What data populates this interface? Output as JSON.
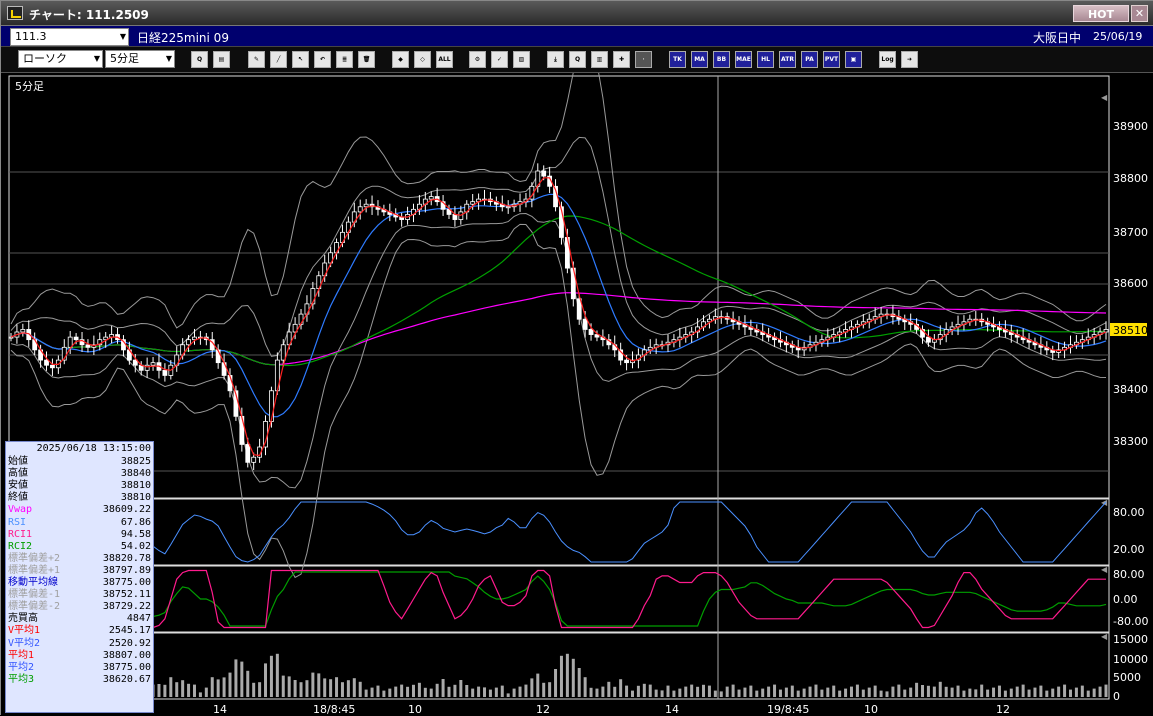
{
  "window": {
    "title": "チャート: 111.2509",
    "hot_label": "HOT",
    "close_label": "✕"
  },
  "infobar": {
    "code": "111.3",
    "name": "日経225mini 09",
    "session": "大阪日中",
    "date": "25/06/19"
  },
  "toolbar": {
    "chart_type": "ローソク",
    "interval": "5分足",
    "buttons": [
      {
        "icon": "zoom-icon",
        "text": "Q"
      },
      {
        "icon": "window-icon",
        "text": "▤"
      },
      {
        "icon": "pencil-icon",
        "text": "✎"
      },
      {
        "icon": "line-tool-icon",
        "text": "╱"
      },
      {
        "icon": "cursor-icon",
        "text": "↖"
      },
      {
        "icon": "undo-icon",
        "text": "↶"
      },
      {
        "icon": "notes-icon",
        "text": "≣"
      },
      {
        "icon": "trash-icon",
        "text": "🗑"
      },
      {
        "icon": "candle-width-icon",
        "text": "◆"
      },
      {
        "icon": "candle-narrow-icon",
        "text": "◇"
      },
      {
        "icon": "all-icon",
        "text": "ALL"
      },
      {
        "icon": "settings-icon",
        "text": "⚙"
      },
      {
        "icon": "wrench-icon",
        "text": "✓"
      },
      {
        "icon": "color-icon",
        "text": "▨"
      },
      {
        "icon": "download-icon",
        "text": "⤓"
      },
      {
        "icon": "search-chart-icon",
        "text": "Q"
      },
      {
        "icon": "bar-chart-icon",
        "text": "▥"
      },
      {
        "icon": "split-icon",
        "text": "✚"
      },
      {
        "icon": "disabled-icon",
        "text": "·"
      },
      {
        "icon": "indicator-icon",
        "text": "TK"
      },
      {
        "icon": "ma-icon",
        "text": "MA"
      },
      {
        "icon": "bb-icon",
        "text": "BB"
      },
      {
        "icon": "mae-icon",
        "text": "MAE"
      },
      {
        "icon": "hl-icon",
        "text": "HL"
      },
      {
        "icon": "atr-icon",
        "text": "ATR"
      },
      {
        "icon": "para-icon",
        "text": "PA"
      },
      {
        "icon": "pvt-icon",
        "text": "PVT"
      },
      {
        "icon": "frame-icon",
        "text": "▣"
      },
      {
        "icon": "log-icon",
        "text": "Log"
      },
      {
        "icon": "export-icon",
        "text": "➜"
      }
    ]
  },
  "colors": {
    "candle": "#ffffff",
    "ma_short": "#ff2020",
    "ma_mid": "#2e7bff",
    "ma_long": "#00a000",
    "vwap": "#ff00ff",
    "bands": "#999999",
    "rsi": "#4a90ff",
    "rci1": "#ff1b8d",
    "rci2": "#009e00",
    "price_tag_bg": "#ffe000",
    "panel_border": "#dddddd",
    "crosshair": "#aaaaaa"
  },
  "main_chart": {
    "label": "5分足",
    "price_axis": [
      "38900",
      "38800",
      "38700",
      "38600",
      "38400",
      "38300"
    ],
    "current_price": "38510",
    "time_axis": [
      "14",
      "18/8:45",
      "10",
      "12",
      "14",
      "19/8:45",
      "10",
      "12"
    ]
  },
  "rsi_panel": {
    "axis": [
      "80.00",
      "20.00"
    ]
  },
  "rci_panel": {
    "axis": [
      "80.00",
      "0.00",
      "-80.00"
    ]
  },
  "volume_panel": {
    "axis": [
      "15000",
      "10000",
      "5000",
      "0"
    ]
  },
  "data_panel": {
    "datetime": "2025/06/18  13:15:00",
    "rows": [
      {
        "label": "始値",
        "value": "38825",
        "color": "#000000"
      },
      {
        "label": "高値",
        "value": "38840",
        "color": "#000000"
      },
      {
        "label": "安値",
        "value": "38810",
        "color": "#000000"
      },
      {
        "label": "終値",
        "value": "38810",
        "color": "#000000"
      },
      {
        "label": "Vwap",
        "value": "38609.22",
        "color": "#ff00ff"
      },
      {
        "label": "RSI",
        "value": "67.86",
        "color": "#4a90ff"
      },
      {
        "label": "RCI1",
        "value": "94.58",
        "color": "#ff1b8d"
      },
      {
        "label": "RCI2",
        "value": "54.02",
        "color": "#009e00"
      },
      {
        "label": "標準偏差+2",
        "value": "38820.78",
        "color": "#a0a0a0"
      },
      {
        "label": "標準偏差+1",
        "value": "38797.89",
        "color": "#a0a0a0"
      },
      {
        "label": "移動平均線",
        "value": "38775.00",
        "color": "#0000cc"
      },
      {
        "label": "標準偏差-1",
        "value": "38752.11",
        "color": "#a0a0a0"
      },
      {
        "label": "標準偏差-2",
        "value": "38729.22",
        "color": "#a0a0a0"
      },
      {
        "label": "売買高",
        "value": "4847",
        "color": "#000000"
      },
      {
        "label": "V平均1",
        "value": "2545.17",
        "color": "#ff0000"
      },
      {
        "label": "V平均2",
        "value": "2520.92",
        "color": "#3355ff"
      },
      {
        "label": "平均1",
        "value": "38807.00",
        "color": "#ff0000"
      },
      {
        "label": "平均2",
        "value": "38775.00",
        "color": "#3355ff"
      },
      {
        "label": "平均3",
        "value": "38620.67",
        "color": "#009e00"
      }
    ]
  },
  "chart_data": {
    "type": "candlestick",
    "interval": "5分足",
    "symbol": "日経225mini 09",
    "time_labels": [
      "14",
      "18/8:45",
      "10",
      "12",
      "14",
      "19/8:45",
      "10",
      "12"
    ],
    "ylim": [
      38240,
      39050
    ],
    "closes": [
      38545,
      38555,
      38560,
      38540,
      38520,
      38500,
      38490,
      38485,
      38500,
      38525,
      38545,
      38540,
      38530,
      38525,
      38530,
      38540,
      38545,
      38550,
      38540,
      38520,
      38500,
      38490,
      38480,
      38490,
      38495,
      38480,
      38470,
      38490,
      38510,
      38530,
      38540,
      38545,
      38545,
      38540,
      38520,
      38495,
      38470,
      38440,
      38390,
      38335,
      38300,
      38310,
      38330,
      38380,
      38440,
      38500,
      38530,
      38555,
      38570,
      38590,
      38610,
      38640,
      38665,
      38690,
      38710,
      38730,
      38750,
      38770,
      38790,
      38800,
      38805,
      38800,
      38795,
      38790,
      38785,
      38780,
      38775,
      38785,
      38795,
      38805,
      38815,
      38820,
      38810,
      38795,
      38785,
      38775,
      38790,
      38805,
      38810,
      38815,
      38815,
      38810,
      38805,
      38800,
      38800,
      38805,
      38810,
      38815,
      38840,
      38870,
      38860,
      38840,
      38800,
      38740,
      38680,
      38620,
      38580,
      38560,
      38550,
      38545,
      38540,
      38530,
      38520,
      38500,
      38495,
      38500,
      38510,
      38520,
      38525,
      38530,
      38530,
      38535,
      38540,
      38545,
      38550,
      38555,
      38565,
      38575,
      38580,
      38585,
      38585,
      38580,
      38575,
      38570,
      38565,
      38560,
      38555,
      38550,
      38545,
      38540,
      38535,
      38530,
      38525,
      38520,
      38525,
      38530,
      38535,
      38540,
      38545,
      38550,
      38555,
      38560,
      38565,
      38570,
      38575,
      38580,
      38585,
      38590,
      38590,
      38585,
      38580,
      38575,
      38570,
      38560,
      38545,
      38535,
      38540,
      38550,
      38560,
      38565,
      38570,
      38575,
      38580,
      38580,
      38575,
      38570,
      38565,
      38560,
      38555,
      38550,
      38545,
      38540,
      38535,
      38530,
      38525,
      38520,
      38515,
      38520,
      38525,
      38530,
      38535,
      38540,
      38545,
      38550,
      38555,
      38560
    ],
    "volume_max": 15000
  }
}
